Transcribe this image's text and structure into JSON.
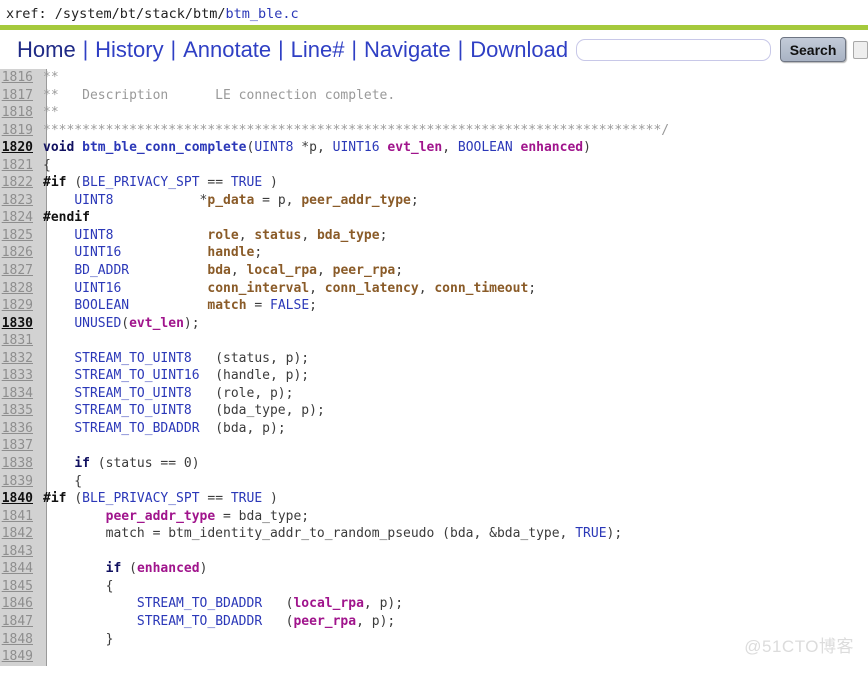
{
  "xref": {
    "label": "xref: ",
    "path": "/system/bt/stack/btm/",
    "file": "btm_ble.c"
  },
  "menu": {
    "items": [
      {
        "label": "Home",
        "name": "home",
        "current": true
      },
      {
        "label": "History",
        "name": "history",
        "current": false
      },
      {
        "label": "Annotate",
        "name": "annotate",
        "current": false
      },
      {
        "label": "Line#",
        "name": "linenum",
        "current": false
      },
      {
        "label": "Navigate",
        "name": "navigate",
        "current": false
      },
      {
        "label": "Download",
        "name": "download",
        "current": false
      }
    ],
    "separator": "|",
    "search": {
      "value": "",
      "placeholder": "",
      "button_label": "Search"
    }
  },
  "watermark": "@51CTO博客",
  "colors": {
    "green_rule": "#a5c93c",
    "link": "#2b38b8",
    "comment": "#999999",
    "var": "#8a5b28",
    "param": "#a0148c",
    "gutter": "#d2d2d2"
  },
  "code": {
    "first_line": 1816,
    "lines": [
      {
        "n": 1816,
        "hl": false,
        "tokens": [
          {
            "t": "**",
            "c": "c-cmt"
          }
        ]
      },
      {
        "n": 1817,
        "hl": false,
        "tokens": [
          {
            "t": "**   Description      LE connection complete.",
            "c": "c-cmt"
          }
        ]
      },
      {
        "n": 1818,
        "hl": false,
        "tokens": [
          {
            "t": "**",
            "c": "c-cmt"
          }
        ]
      },
      {
        "n": 1819,
        "hl": false,
        "tokens": [
          {
            "t": "*******************************************************************************/",
            "c": "c-cmt"
          }
        ]
      },
      {
        "n": 1820,
        "hl": true,
        "tokens": [
          {
            "t": "void ",
            "c": "c-kw"
          },
          {
            "t": "btm_ble_conn_complete",
            "c": "c-fn"
          },
          {
            "t": "(",
            "c": "c-plain"
          },
          {
            "t": "UINT8",
            "c": "c-type"
          },
          {
            "t": " *p, ",
            "c": "c-plain"
          },
          {
            "t": "UINT16",
            "c": "c-type"
          },
          {
            "t": " ",
            "c": "c-plain"
          },
          {
            "t": "evt_len",
            "c": "c-param"
          },
          {
            "t": ", ",
            "c": "c-plain"
          },
          {
            "t": "BOOLEAN",
            "c": "c-type"
          },
          {
            "t": " ",
            "c": "c-plain"
          },
          {
            "t": "enhanced",
            "c": "c-param"
          },
          {
            "t": ")",
            "c": "c-plain"
          }
        ]
      },
      {
        "n": 1821,
        "hl": false,
        "tokens": [
          {
            "t": "{",
            "c": "c-plain"
          }
        ]
      },
      {
        "n": 1822,
        "hl": false,
        "tokens": [
          {
            "t": "#if ",
            "c": "c-pre"
          },
          {
            "t": "(",
            "c": "c-plain"
          },
          {
            "t": "BLE_PRIVACY_SPT",
            "c": "c-type"
          },
          {
            "t": " == ",
            "c": "c-plain"
          },
          {
            "t": "TRUE",
            "c": "c-const"
          },
          {
            "t": " )",
            "c": "c-plain"
          }
        ]
      },
      {
        "n": 1823,
        "hl": false,
        "tokens": [
          {
            "t": "    ",
            "c": "c-plain"
          },
          {
            "t": "UINT8",
            "c": "c-type"
          },
          {
            "t": "           *",
            "c": "c-plain"
          },
          {
            "t": "p_data",
            "c": "c-var"
          },
          {
            "t": " = p, ",
            "c": "c-plain"
          },
          {
            "t": "peer_addr_type",
            "c": "c-var"
          },
          {
            "t": ";",
            "c": "c-plain"
          }
        ]
      },
      {
        "n": 1824,
        "hl": false,
        "tokens": [
          {
            "t": "#endif",
            "c": "c-pre"
          }
        ]
      },
      {
        "n": 1825,
        "hl": false,
        "tokens": [
          {
            "t": "    ",
            "c": "c-plain"
          },
          {
            "t": "UINT8",
            "c": "c-type"
          },
          {
            "t": "            ",
            "c": "c-plain"
          },
          {
            "t": "role",
            "c": "c-var"
          },
          {
            "t": ", ",
            "c": "c-plain"
          },
          {
            "t": "status",
            "c": "c-var"
          },
          {
            "t": ", ",
            "c": "c-plain"
          },
          {
            "t": "bda_type",
            "c": "c-var"
          },
          {
            "t": ";",
            "c": "c-plain"
          }
        ]
      },
      {
        "n": 1826,
        "hl": false,
        "tokens": [
          {
            "t": "    ",
            "c": "c-plain"
          },
          {
            "t": "UINT16",
            "c": "c-type"
          },
          {
            "t": "           ",
            "c": "c-plain"
          },
          {
            "t": "handle",
            "c": "c-var"
          },
          {
            "t": ";",
            "c": "c-plain"
          }
        ]
      },
      {
        "n": 1827,
        "hl": false,
        "tokens": [
          {
            "t": "    ",
            "c": "c-plain"
          },
          {
            "t": "BD_ADDR",
            "c": "c-type"
          },
          {
            "t": "          ",
            "c": "c-plain"
          },
          {
            "t": "bda",
            "c": "c-var"
          },
          {
            "t": ", ",
            "c": "c-plain"
          },
          {
            "t": "local_rpa",
            "c": "c-var"
          },
          {
            "t": ", ",
            "c": "c-plain"
          },
          {
            "t": "peer_rpa",
            "c": "c-var"
          },
          {
            "t": ";",
            "c": "c-plain"
          }
        ]
      },
      {
        "n": 1828,
        "hl": false,
        "tokens": [
          {
            "t": "    ",
            "c": "c-plain"
          },
          {
            "t": "UINT16",
            "c": "c-type"
          },
          {
            "t": "           ",
            "c": "c-plain"
          },
          {
            "t": "conn_interval",
            "c": "c-var"
          },
          {
            "t": ", ",
            "c": "c-plain"
          },
          {
            "t": "conn_latency",
            "c": "c-var"
          },
          {
            "t": ", ",
            "c": "c-plain"
          },
          {
            "t": "conn_timeout",
            "c": "c-var"
          },
          {
            "t": ";",
            "c": "c-plain"
          }
        ]
      },
      {
        "n": 1829,
        "hl": false,
        "tokens": [
          {
            "t": "    ",
            "c": "c-plain"
          },
          {
            "t": "BOOLEAN",
            "c": "c-type"
          },
          {
            "t": "          ",
            "c": "c-plain"
          },
          {
            "t": "match",
            "c": "c-var"
          },
          {
            "t": " = ",
            "c": "c-plain"
          },
          {
            "t": "FALSE",
            "c": "c-const"
          },
          {
            "t": ";",
            "c": "c-plain"
          }
        ]
      },
      {
        "n": 1830,
        "hl": true,
        "tokens": [
          {
            "t": "    ",
            "c": "c-plain"
          },
          {
            "t": "UNUSED",
            "c": "c-type"
          },
          {
            "t": "(",
            "c": "c-plain"
          },
          {
            "t": "evt_len",
            "c": "c-param"
          },
          {
            "t": ");",
            "c": "c-plain"
          }
        ]
      },
      {
        "n": 1831,
        "hl": false,
        "tokens": []
      },
      {
        "n": 1832,
        "hl": false,
        "tokens": [
          {
            "t": "    ",
            "c": "c-plain"
          },
          {
            "t": "STREAM_TO_UINT8",
            "c": "c-type"
          },
          {
            "t": "   (status, p);",
            "c": "c-plain"
          }
        ]
      },
      {
        "n": 1833,
        "hl": false,
        "tokens": [
          {
            "t": "    ",
            "c": "c-plain"
          },
          {
            "t": "STREAM_TO_UINT16",
            "c": "c-type"
          },
          {
            "t": "  (handle, p);",
            "c": "c-plain"
          }
        ]
      },
      {
        "n": 1834,
        "hl": false,
        "tokens": [
          {
            "t": "    ",
            "c": "c-plain"
          },
          {
            "t": "STREAM_TO_UINT8",
            "c": "c-type"
          },
          {
            "t": "   (role, p);",
            "c": "c-plain"
          }
        ]
      },
      {
        "n": 1835,
        "hl": false,
        "tokens": [
          {
            "t": "    ",
            "c": "c-plain"
          },
          {
            "t": "STREAM_TO_UINT8",
            "c": "c-type"
          },
          {
            "t": "   (bda_type, p);",
            "c": "c-plain"
          }
        ]
      },
      {
        "n": 1836,
        "hl": false,
        "tokens": [
          {
            "t": "    ",
            "c": "c-plain"
          },
          {
            "t": "STREAM_TO_BDADDR",
            "c": "c-type"
          },
          {
            "t": "  (bda, p);",
            "c": "c-plain"
          }
        ]
      },
      {
        "n": 1837,
        "hl": false,
        "tokens": []
      },
      {
        "n": 1838,
        "hl": false,
        "tokens": [
          {
            "t": "    ",
            "c": "c-plain"
          },
          {
            "t": "if",
            "c": "c-kw"
          },
          {
            "t": " (status == 0)",
            "c": "c-plain"
          }
        ]
      },
      {
        "n": 1839,
        "hl": false,
        "tokens": [
          {
            "t": "    {",
            "c": "c-plain"
          }
        ]
      },
      {
        "n": 1840,
        "hl": true,
        "tokens": [
          {
            "t": "#if ",
            "c": "c-pre"
          },
          {
            "t": "(",
            "c": "c-plain"
          },
          {
            "t": "BLE_PRIVACY_SPT",
            "c": "c-type"
          },
          {
            "t": " == ",
            "c": "c-plain"
          },
          {
            "t": "TRUE",
            "c": "c-const"
          },
          {
            "t": " )",
            "c": "c-plain"
          }
        ]
      },
      {
        "n": 1841,
        "hl": false,
        "tokens": [
          {
            "t": "        ",
            "c": "c-plain"
          },
          {
            "t": "peer_addr_type",
            "c": "c-param"
          },
          {
            "t": " = bda_type;",
            "c": "c-plain"
          }
        ]
      },
      {
        "n": 1842,
        "hl": false,
        "tokens": [
          {
            "t": "        match = btm_identity_addr_to_random_pseudo (bda, &bda_type, ",
            "c": "c-plain"
          },
          {
            "t": "TRUE",
            "c": "c-const"
          },
          {
            "t": ");",
            "c": "c-plain"
          }
        ]
      },
      {
        "n": 1843,
        "hl": false,
        "tokens": []
      },
      {
        "n": 1844,
        "hl": false,
        "tokens": [
          {
            "t": "        ",
            "c": "c-plain"
          },
          {
            "t": "if",
            "c": "c-kw"
          },
          {
            "t": " (",
            "c": "c-plain"
          },
          {
            "t": "enhanced",
            "c": "c-param"
          },
          {
            "t": ")",
            "c": "c-plain"
          }
        ]
      },
      {
        "n": 1845,
        "hl": false,
        "tokens": [
          {
            "t": "        {",
            "c": "c-plain"
          }
        ]
      },
      {
        "n": 1846,
        "hl": false,
        "tokens": [
          {
            "t": "            ",
            "c": "c-plain"
          },
          {
            "t": "STREAM_TO_BDADDR",
            "c": "c-type"
          },
          {
            "t": "   (",
            "c": "c-plain"
          },
          {
            "t": "local_rpa",
            "c": "c-param"
          },
          {
            "t": ", p);",
            "c": "c-plain"
          }
        ]
      },
      {
        "n": 1847,
        "hl": false,
        "tokens": [
          {
            "t": "            ",
            "c": "c-plain"
          },
          {
            "t": "STREAM_TO_BDADDR",
            "c": "c-type"
          },
          {
            "t": "   (",
            "c": "c-plain"
          },
          {
            "t": "peer_rpa",
            "c": "c-param"
          },
          {
            "t": ", p);",
            "c": "c-plain"
          }
        ]
      },
      {
        "n": 1848,
        "hl": false,
        "tokens": [
          {
            "t": "        }",
            "c": "c-plain"
          }
        ]
      },
      {
        "n": 1849,
        "hl": false,
        "tokens": []
      }
    ]
  }
}
